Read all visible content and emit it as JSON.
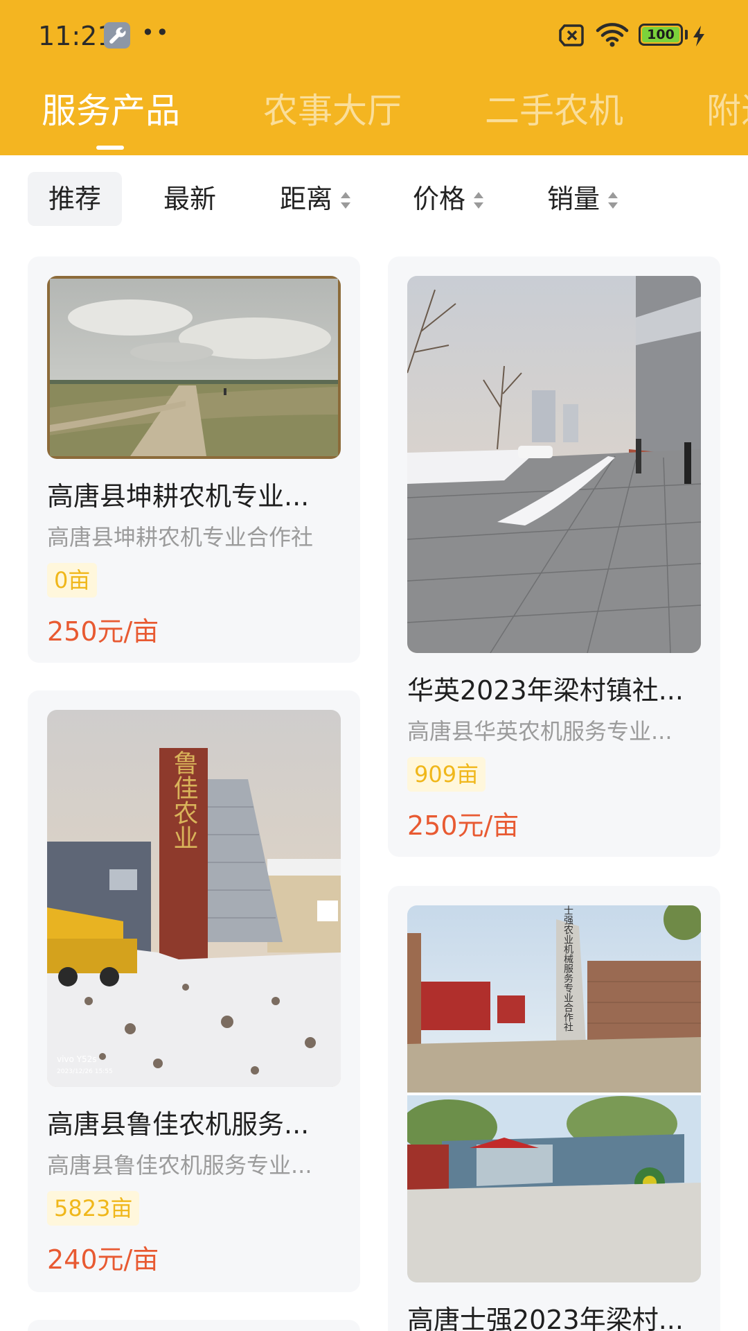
{
  "status_bar": {
    "time": "11:21",
    "battery": "100",
    "icons": [
      "wrench-icon",
      "more-dots-icon",
      "sim-off-icon",
      "wifi-icon",
      "battery-icon",
      "charging-bolt-icon"
    ]
  },
  "colors": {
    "header": "#f4b521",
    "price": "#e85a32",
    "tag_text": "#f0b71b",
    "tag_bg": "#fff7dc",
    "card_bg": "#f6f7f9"
  },
  "tabs": [
    {
      "label": "服务产品",
      "active": true
    },
    {
      "label": "农事大厅",
      "active": false
    },
    {
      "label": "二手农机",
      "active": false
    },
    {
      "label": "附近",
      "active": false
    }
  ],
  "filters": [
    {
      "label": "推荐",
      "active": true
    },
    {
      "label": "最新",
      "sortable": false
    },
    {
      "label": "距离",
      "sortable": true
    },
    {
      "label": "价格",
      "sortable": true
    },
    {
      "label": "销量",
      "sortable": true
    }
  ],
  "products": [
    {
      "title": "高唐县坤耕农机专业...",
      "subtitle": "高唐县坤耕农机专业合作社",
      "tag": "0亩",
      "price": "250元/亩",
      "image": "farmland-road-photo"
    },
    {
      "title": "华英2023年梁村镇社...",
      "subtitle": "高唐县华英农机服务专业...",
      "tag": "909亩",
      "price": "250元/亩",
      "image": "snowy-plaza-photo"
    },
    {
      "title": "高唐县鲁佳农机服务...",
      "subtitle": "高唐县鲁佳农机服务专业...",
      "tag": "5823亩",
      "price": "240元/亩",
      "image": "lujia-sign-photo",
      "image_text": "鲁佳农业",
      "watermark": "vivo Y52s",
      "watermark_date": "2023/12/26 15:55"
    },
    {
      "title": "高唐士强2023年梁村...",
      "subtitle": "",
      "tag": "",
      "price": "",
      "image": "shiqiang-yard-photo",
      "image_text": "高唐县士强农业机械服务专业合作社"
    }
  ]
}
